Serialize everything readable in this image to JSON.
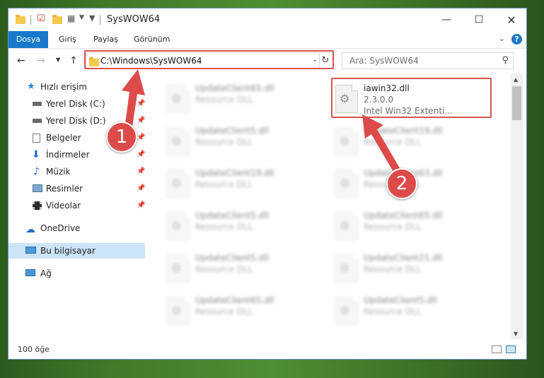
{
  "window": {
    "title": "SysWOW64"
  },
  "ribbon": {
    "tabs": [
      {
        "label": "Dosya",
        "active": true
      },
      {
        "label": "Giriş",
        "active": false
      },
      {
        "label": "Paylaş",
        "active": false
      },
      {
        "label": "Görünüm",
        "active": false
      }
    ],
    "help": "?"
  },
  "addressbar": {
    "path": "C:\\Windows\\SysWOW64",
    "search_placeholder": "Ara: SysWOW64"
  },
  "sidebar": {
    "quick_access": "Hızlı erişim",
    "items": [
      {
        "label": "Yerel Disk (C:)",
        "icon": "drive-icon"
      },
      {
        "label": "Yerel Disk (D:)",
        "icon": "drive-icon"
      },
      {
        "label": "Belgeler",
        "icon": "documents-icon"
      },
      {
        "label": "İndirmeler",
        "icon": "downloads-icon"
      },
      {
        "label": "Müzik",
        "icon": "music-icon"
      },
      {
        "label": "Resimler",
        "icon": "pictures-icon"
      },
      {
        "label": "Videolar",
        "icon": "videos-icon"
      }
    ],
    "onedrive": "OneDrive",
    "this_pc": "Bu bilgisayar",
    "network": "Ağ"
  },
  "files": {
    "highlighted": {
      "name": "iawin32.dll",
      "version": "2.3.0.0",
      "description": "Intel Win32 Extenti..."
    },
    "left_column": [
      {
        "name": "UpdateClient65.dll",
        "description": "Resource DLL"
      },
      {
        "name": "UpdateClient5.dll",
        "description": "Resource DLL"
      },
      {
        "name": "UpdateClient19.dll",
        "description": "Resource DLL"
      },
      {
        "name": "UpdateClient5.dll",
        "description": "Resource DLL"
      },
      {
        "name": "UpdateClient5.dll",
        "description": "Resource DLL"
      },
      {
        "name": "UpdateClient65.dll",
        "description": "Resource DLL"
      }
    ],
    "right_column": [
      {
        "name": "UpdateClient19.dll",
        "description": "Resource DLL"
      },
      {
        "name": "UpdateClient63.dll",
        "description": "Resource DLL"
      },
      {
        "name": "UpdateClient65.dll",
        "description": "Resource DLL"
      },
      {
        "name": "UpdateClient21.dll",
        "description": "Resource DLL"
      },
      {
        "name": "UpdateClient5.dll",
        "description": "Resource DLL"
      }
    ]
  },
  "status": {
    "item_count": "100 öğe"
  },
  "callouts": {
    "one": "1",
    "two": "2"
  },
  "colors": {
    "accent": "#1979ca",
    "highlight": "#d9534f",
    "callout": "#dc4a4a"
  }
}
